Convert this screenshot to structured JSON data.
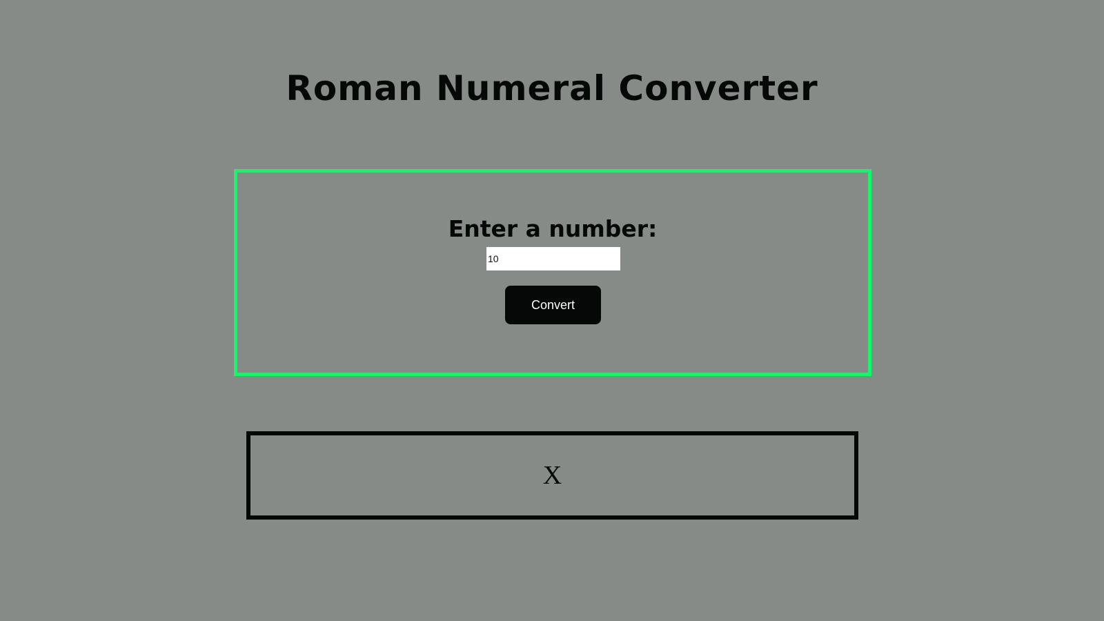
{
  "page": {
    "title": "Roman Numeral Converter",
    "background_color": "#878b87"
  },
  "form": {
    "label": "Enter a number:",
    "input_value": "10",
    "button_label": "Convert",
    "accent_color": "#15f56a"
  },
  "output": {
    "value": "X"
  }
}
